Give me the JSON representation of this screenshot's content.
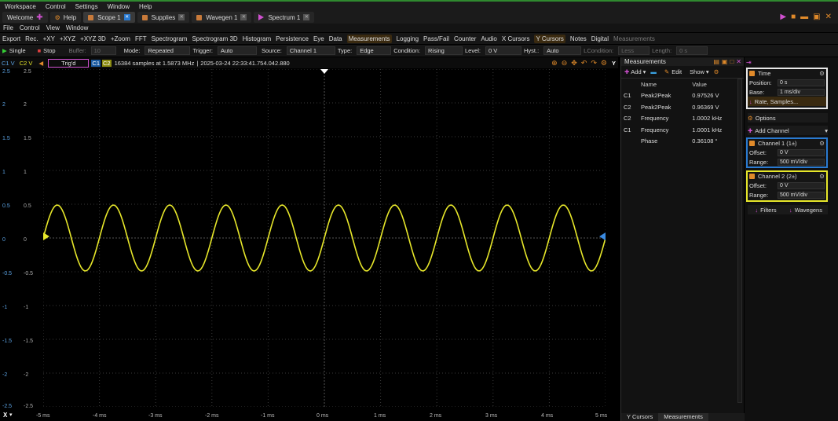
{
  "topbar": {
    "workspace": "Workspace",
    "control": "Control",
    "settings": "Settings",
    "window": "Window",
    "help": "Help",
    "tabs": [
      {
        "label": "Welcome",
        "kind": "plus"
      },
      {
        "label": "Help",
        "kind": "gear"
      },
      {
        "label": "Scope 1",
        "kind": "sq",
        "close": "blue"
      },
      {
        "label": "Supplies",
        "kind": "sq",
        "close": "grey"
      },
      {
        "label": "Wavegen 1",
        "kind": "sq",
        "close": "grey"
      },
      {
        "label": "Spectrum 1",
        "kind": "tri",
        "close": "grey"
      }
    ]
  },
  "menubar": [
    "File",
    "Control",
    "View",
    "Window"
  ],
  "toolbar": [
    "Export",
    "Rec.",
    "+XY",
    "+XYZ",
    "+XYZ 3D",
    "+Zoom",
    "FFT",
    "Spectrogram",
    "Spectrogram 3D",
    "Histogram",
    "Persistence",
    "Eye",
    "Data",
    "Measurements",
    "Logging",
    "Pass/Fail",
    "Counter",
    "Audio",
    "X Cursors",
    "Y Cursors",
    "Notes",
    "Digital",
    "Measurements"
  ],
  "ctrl": {
    "single": "Single",
    "stop": "Stop",
    "buffer_label": "Buffer:",
    "buffer": "10",
    "mode_label": "Mode:",
    "mode": "Repeated",
    "trigger_label": "Trigger:",
    "trigger": "Auto",
    "source_label": "Source:",
    "source": "Channel 1",
    "type_label": "Type:",
    "type": "Edge",
    "condition_label": "Condition:",
    "condition": "Rising",
    "level_label": "Level:",
    "level": "0 V",
    "hyst_label": "Hyst.:",
    "hyst": "Auto",
    "lcond_label": "LCondition:",
    "lcond": "Less",
    "length_label": "Length:",
    "length": "0 s"
  },
  "plot": {
    "c1": "C1 V",
    "c2": "C2 V",
    "status": "Trig'd",
    "info": "16384 samples at 1.5873 MHz",
    "timestamp": "2025-03-24 22:33:41.754.042.880",
    "c1tag": "C1",
    "c2tag": "C2",
    "ylabel": "Y",
    "xlabel": "X",
    "yticks": [
      "2.5",
      "2",
      "1.5",
      "1",
      "0.5",
      "0",
      "-0.5",
      "-1",
      "-1.5",
      "-2",
      "-2.5"
    ],
    "xticks": [
      "-5 ms",
      "-4 ms",
      "-3 ms",
      "-2 ms",
      "-1 ms",
      "0 ms",
      "1 ms",
      "2 ms",
      "3 ms",
      "4 ms",
      "5 ms"
    ],
    "wave_color": "#e6e62a",
    "freq_khz": 1.0,
    "amplitude_v": 0.487
  },
  "measurements": {
    "title": "Measurements",
    "add": "Add",
    "edit": "Edit",
    "show": "Show",
    "col_name": "Name",
    "col_value": "Value",
    "rows": [
      {
        "ch": "C1",
        "name": "Peak2Peak",
        "value": "0.97526 V"
      },
      {
        "ch": "C2",
        "name": "Peak2Peak",
        "value": "0.96369 V"
      },
      {
        "ch": "C2",
        "name": "Frequency",
        "value": "1.0002 kHz"
      },
      {
        "ch": "C1",
        "name": "Frequency",
        "value": "1.0001 kHz"
      },
      {
        "ch": "",
        "name": "Phase",
        "value": "0.36108 °"
      }
    ],
    "tab_ycursors": "Y Cursors",
    "tab_measurements": "Measurements"
  },
  "side": {
    "time": "Time",
    "position_label": "Position:",
    "position": "0 s",
    "base_label": "Base:",
    "base": "1 ms/div",
    "rate": "Rate, Samples...",
    "options": "Options",
    "add_channel": "Add Channel",
    "ch1": "Channel 1 (1±)",
    "ch1_offset_label": "Offset:",
    "ch1_offset": "0 V",
    "ch1_range_label": "Range:",
    "ch1_range": "500 mV/div",
    "ch2": "Channel 2 (2±)",
    "ch2_offset_label": "Offset:",
    "ch2_offset": "0 V",
    "ch2_range_label": "Range:",
    "ch2_range": "500 mV/div",
    "filters": "Filters",
    "wavegens": "Wavegens"
  }
}
